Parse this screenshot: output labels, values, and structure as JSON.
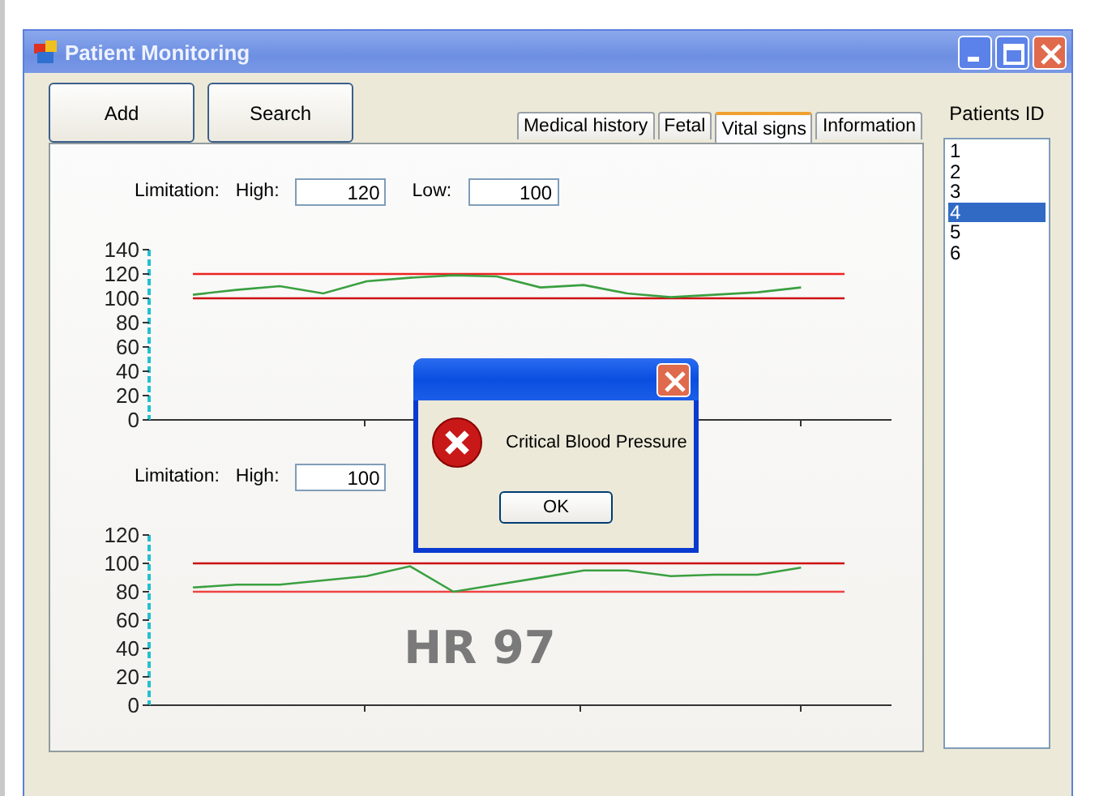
{
  "window": {
    "title": "Patient Monitoring"
  },
  "buttons": [
    "Add",
    "Search"
  ],
  "tabs": [
    {
      "label": "Medical history",
      "selected": false
    },
    {
      "label": "Fetal",
      "selected": false
    },
    {
      "label": "Vital signs",
      "selected": true
    },
    {
      "label": "Information",
      "selected": false
    }
  ],
  "patients": {
    "title": "Patients ID",
    "items": [
      {
        "label": "1",
        "selected": false
      },
      {
        "label": "2",
        "selected": false
      },
      {
        "label": "3",
        "selected": false
      },
      {
        "label": "4",
        "selected": true
      },
      {
        "label": "5",
        "selected": false
      },
      {
        "label": "6",
        "selected": false
      }
    ]
  },
  "panels": [
    {
      "limits": [
        {
          "label": "Limitation:"
        },
        {
          "label": "High:",
          "value": "120"
        },
        {
          "label": "Low:",
          "value": "100"
        }
      ],
      "chart_data": {
        "type": "line",
        "ylim": [
          0,
          140
        ],
        "yticks": [
          0,
          20,
          40,
          60,
          80,
          100,
          120,
          140
        ],
        "series": [
          {
            "color": "#ee2222",
            "values": [
              120,
              120,
              120,
              120,
              120,
              120,
              120,
              120,
              120,
              120,
              120,
              120,
              120,
              120,
              120,
              120
            ]
          },
          {
            "color": "#cc1111",
            "values": [
              100,
              100,
              100,
              100,
              100,
              100,
              100,
              100,
              100,
              100,
              100,
              100,
              100,
              100,
              100,
              100
            ]
          },
          {
            "color": "#3aa040",
            "values": [
              103,
              107,
              110,
              104,
              114,
              117,
              119,
              118,
              109,
              111,
              104,
              101,
              103,
              105,
              109,
              null
            ]
          }
        ]
      }
    },
    {
      "limits": [
        {
          "label": "Limitation:"
        },
        {
          "label": "High:",
          "value": "100"
        }
      ],
      "reading": "HR 97",
      "chart_data": {
        "type": "line",
        "ylim": [
          0,
          120
        ],
        "yticks": [
          0,
          20,
          40,
          60,
          80,
          100,
          120
        ],
        "series": [
          {
            "color": "#cc1111",
            "values": [
              100,
              100,
              100,
              100,
              100,
              100,
              100,
              100,
              100,
              100,
              100,
              100,
              100,
              100,
              100,
              100
            ]
          },
          {
            "color": "#ee4444",
            "values": [
              80,
              80,
              80,
              80,
              80,
              80,
              80,
              80,
              80,
              80,
              80,
              80,
              80,
              80,
              80,
              80
            ]
          },
          {
            "color": "#3aa040",
            "values": [
              83,
              85,
              85,
              88,
              91,
              98,
              80,
              85,
              90,
              95,
              95,
              91,
              92,
              92,
              97,
              null
            ]
          }
        ]
      }
    }
  ],
  "dialog": {
    "message": "Critical Blood Pressure",
    "button": "OK"
  }
}
